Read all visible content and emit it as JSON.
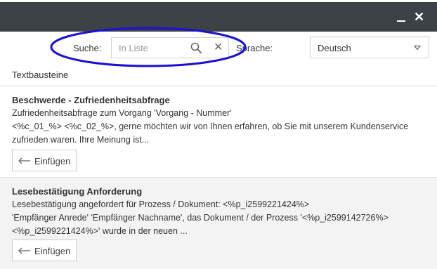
{
  "window": {
    "minimize_glyph": "",
    "close_glyph": "✕"
  },
  "search": {
    "label": "Suche:",
    "placeholder": "In Liste",
    "value": ""
  },
  "language": {
    "label": "Sprache:",
    "selected": "Deutsch"
  },
  "section_title": "Textbausteine",
  "items": [
    {
      "title": "Beschwerde - Zufriedenheitsabfrage",
      "line1": "Zufriedenheitsabfrage zum Vorgang 'Vorgang - Nummer'",
      "line2": "<%c_01_%> <%c_02_%>, gerne möchten wir von Ihnen erfahren, ob Sie mit unserem Kundenservice zufrieden waren. Ihre Meinung ist...",
      "button": "Einfügen"
    },
    {
      "title": "Lesebestätigung Anforderung",
      "line1": "Lesebestätigung angefordert für Prozess / Dokument: <%p_i2599221424%>",
      "line2": "'Empfänger Anrede' 'Empfänger Nachname', das Dokument / der Prozess '<%p_i2599142726%> <%p_i2599221424%>' wurde in der neuen ...",
      "button": "Einfügen"
    }
  ],
  "colors": {
    "titlebar": "#3d4247",
    "highlight_ellipse": "#1a10d6",
    "selected_row": "#f3f3f3"
  },
  "icons": [
    "minimize-icon",
    "close-icon",
    "search-icon",
    "clear-icon",
    "chevron-down-icon",
    "insert-arrow-icon"
  ]
}
